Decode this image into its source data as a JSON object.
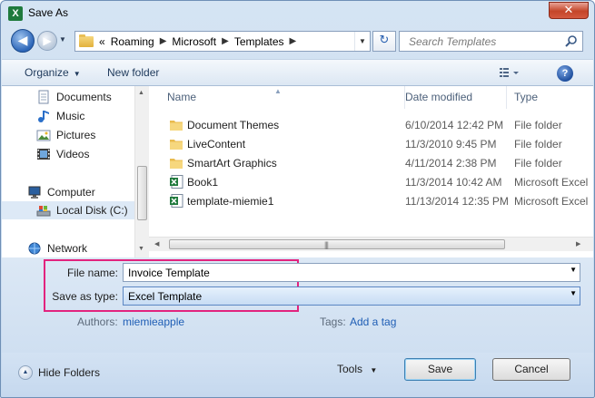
{
  "window": {
    "title": "Save As",
    "close_glyph": "✕",
    "app_icon": "excel-icon"
  },
  "nav": {
    "back_glyph": "◀",
    "forward_glyph": "▶",
    "recent_glyph": "▼",
    "breadcrumb_prefix": "«",
    "breadcrumbs": [
      "Roaming",
      "Microsoft",
      "Templates"
    ],
    "separator": "▶",
    "refresh_glyph": "↻",
    "search_placeholder": "Search Templates"
  },
  "toolbar": {
    "organize": "Organize",
    "new_folder": "New folder",
    "help_glyph": "?"
  },
  "sidebar": {
    "items": [
      {
        "label": "Documents",
        "icon": "documents-icon"
      },
      {
        "label": "Music",
        "icon": "music-icon"
      },
      {
        "label": "Pictures",
        "icon": "pictures-icon"
      },
      {
        "label": "Videos",
        "icon": "videos-icon"
      },
      {
        "label": "Computer",
        "icon": "computer-icon"
      },
      {
        "label": "Local Disk (C:)",
        "icon": "local-disk-icon",
        "selected": true
      },
      {
        "label": "Network",
        "icon": "network-icon"
      }
    ]
  },
  "files": {
    "columns": [
      "Name",
      "Date modified",
      "Type"
    ],
    "rows": [
      {
        "name": "Document Themes",
        "date": "6/10/2014 12:42 PM",
        "type": "File folder",
        "icon": "folder-icon"
      },
      {
        "name": "LiveContent",
        "date": "11/3/2010 9:45 PM",
        "type": "File folder",
        "icon": "folder-icon"
      },
      {
        "name": "SmartArt Graphics",
        "date": "4/11/2014 2:38 PM",
        "type": "File folder",
        "icon": "folder-icon"
      },
      {
        "name": "Book1",
        "date": "11/3/2014 10:42 AM",
        "type": "Microsoft Excel",
        "icon": "excel-file-icon"
      },
      {
        "name": "template-miemie1",
        "date": "11/13/2014 12:35 PM",
        "type": "Microsoft Excel",
        "icon": "excel-file-icon"
      }
    ]
  },
  "form": {
    "file_name_label": "File name:",
    "file_name_value": "Invoice Template",
    "save_type_label": "Save as type:",
    "save_type_value": "Excel Template",
    "authors_label": "Authors:",
    "authors_value": "miemieapple",
    "tags_label": "Tags:",
    "tags_value": "Add a tag"
  },
  "footer": {
    "hide_folders": "Hide Folders",
    "hide_folders_glyph": "▲",
    "tools": "Tools",
    "tools_glyph": "▼",
    "save": "Save",
    "cancel": "Cancel"
  },
  "colors": {
    "highlight": "#e2237e",
    "link": "#1f5eb5",
    "accent": "#2d66b8"
  }
}
